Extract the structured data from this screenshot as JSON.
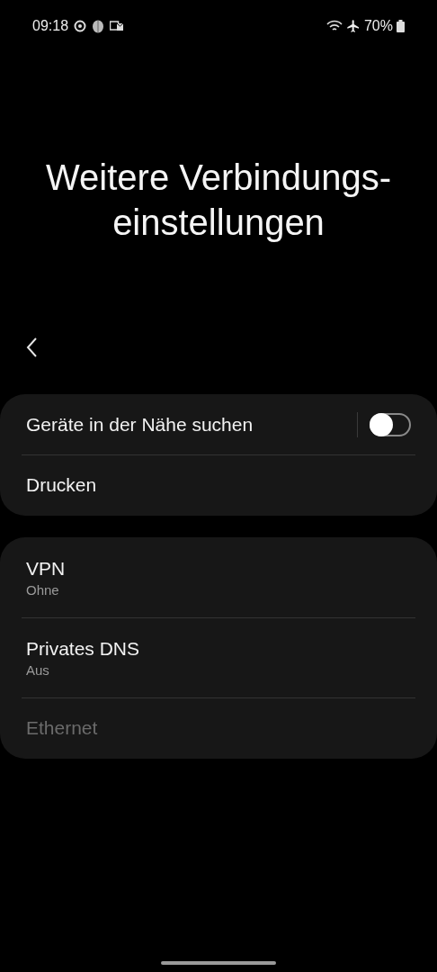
{
  "status_bar": {
    "time": "09:18",
    "battery": "70%"
  },
  "title": "Weitere Verbindungs-\neinstellungen",
  "groups": [
    {
      "items": [
        {
          "kind": "toggle",
          "label": "Geräte in der Nähe suchen",
          "on": false,
          "disabled": false
        },
        {
          "kind": "plain",
          "label": "Drucken",
          "disabled": false
        }
      ]
    },
    {
      "items": [
        {
          "kind": "plain",
          "label": "VPN",
          "summary": "Ohne",
          "disabled": false
        },
        {
          "kind": "plain",
          "label": "Privates DNS",
          "summary": "Aus",
          "disabled": false
        },
        {
          "kind": "plain",
          "label": "Ethernet",
          "disabled": true
        }
      ]
    }
  ]
}
